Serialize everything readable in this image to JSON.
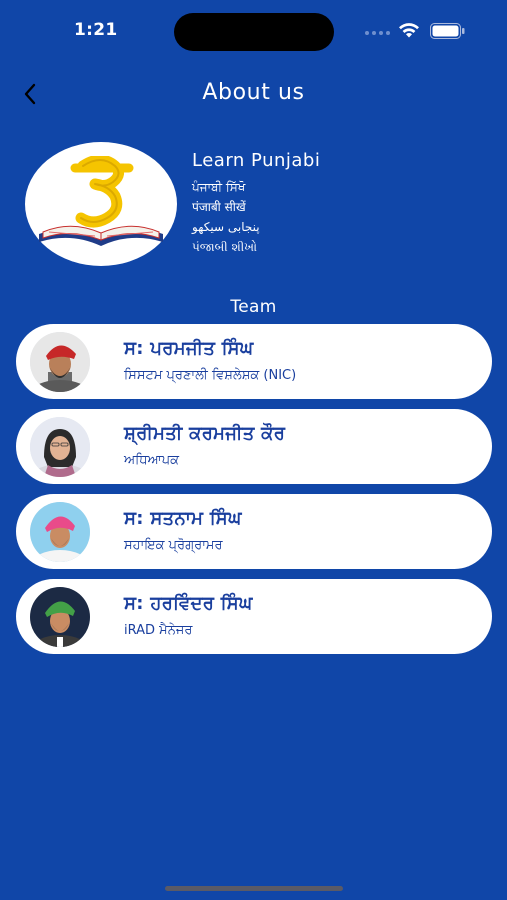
{
  "status_bar": {
    "time": "1:21"
  },
  "nav": {
    "title": "About us",
    "back_icon": "chevron-left-icon"
  },
  "app": {
    "name": "Learn Punjabi",
    "subtitles": [
      "ਪੰਜਾਬੀ ਸਿੱਖੋ",
      "पंजाबी सीखें",
      "پنجابی سیکھو",
      "પંજાબી શીખો"
    ],
    "logo_icon": "ura-letter-book-logo"
  },
  "team": {
    "heading": "Team",
    "members": [
      {
        "name": "ਸ: ਪਰਮਜੀਤ ਸਿੰਘ",
        "role": "ਸਿਸਟਮ ਪ੍ਰਣਾਲੀ ਵਿਸ਼ਲੇਸ਼ਕ (NIC)",
        "turban_color": "#c62828",
        "bg_color": "#e7e7e7"
      },
      {
        "name": "ਸ਼੍ਰੀਮਤੀ ਕਰਮਜੀਤ ਕੌਰ",
        "role": "ਅਧਿਆਪਕ",
        "turban_color": "#2b2b2b",
        "bg_color": "#e6e9f2"
      },
      {
        "name": "ਸ: ਸਤਨਾਮ ਸਿੰਘ",
        "role": "ਸਹਾਇਕ ਪ੍ਰੋਗ੍ਰਾਮਰ",
        "turban_color": "#e94b8a",
        "bg_color": "#8fd0ee"
      },
      {
        "name": "ਸ: ਹਰਵਿੰਦਰ ਸਿੰਘ",
        "role": "iRAD ਮੈਨੇਜਰ",
        "turban_color": "#43a047",
        "bg_color": "#1c2a44"
      }
    ]
  },
  "colors": {
    "background": "#1046a8",
    "card": "#ffffff",
    "card_text": "#1a3f9e"
  }
}
